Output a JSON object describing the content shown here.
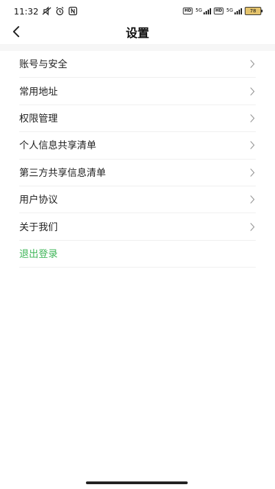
{
  "status_bar": {
    "time": "11:32",
    "hd1": "HD",
    "net1": "5G",
    "hd2": "HD",
    "net2": "5G",
    "battery": "78"
  },
  "header": {
    "title": "设置"
  },
  "menu": {
    "items": [
      {
        "label": "账号与安全"
      },
      {
        "label": "常用地址"
      },
      {
        "label": "权限管理"
      },
      {
        "label": "个人信息共享清单"
      },
      {
        "label": "第三方共享信息清单"
      },
      {
        "label": "用户协议"
      },
      {
        "label": "关于我们"
      }
    ],
    "logout_label": "退出登录",
    "logout_color": "#3fb658"
  }
}
